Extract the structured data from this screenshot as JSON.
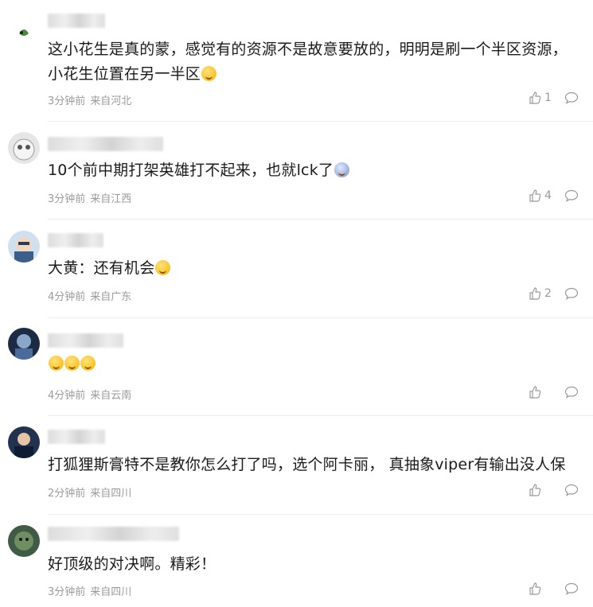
{
  "comments": [
    {
      "text": "这小花生是真的蒙，感觉有的资源不是故意要放的，明明是刷一个半区资源，小花生位置在另一半区",
      "time": "3分钟前",
      "location": "来自河北",
      "likes": "1",
      "emoji": "😔"
    },
    {
      "name_fragment": "蛋",
      "text": "10个前中期打架英雄打不起来，也就lck了",
      "time": "3分钟前",
      "location": "来自江西",
      "likes": "4",
      "emoji": "😱"
    },
    {
      "name_fragment": "川是猫猫",
      "text": "大黄：还有机会",
      "time": "4分钟前",
      "location": "来自广东",
      "likes": "2",
      "emoji": "🐱"
    },
    {
      "name_fragment": "帆",
      "text": "",
      "time": "4分钟前",
      "location": "来自云南",
      "likes": "",
      "emoji": "😂😂😂"
    },
    {
      "text": "打狐狸斯膏特不是教你怎么打了吗，选个阿卡丽， 真抽象viper有输出没人保",
      "time": "2分钟前",
      "location": "来自四川",
      "likes": ""
    },
    {
      "text": "好顶级的对决啊。精彩！",
      "time": "3分钟前",
      "location": "来自四川",
      "likes": ""
    }
  ],
  "colors": {
    "meta": "#9a9a9a",
    "text": "#1a1a1a",
    "separator": "#ededed"
  },
  "icons": {
    "like": "thumbs-up-icon",
    "reply": "speech-bubble-icon"
  }
}
